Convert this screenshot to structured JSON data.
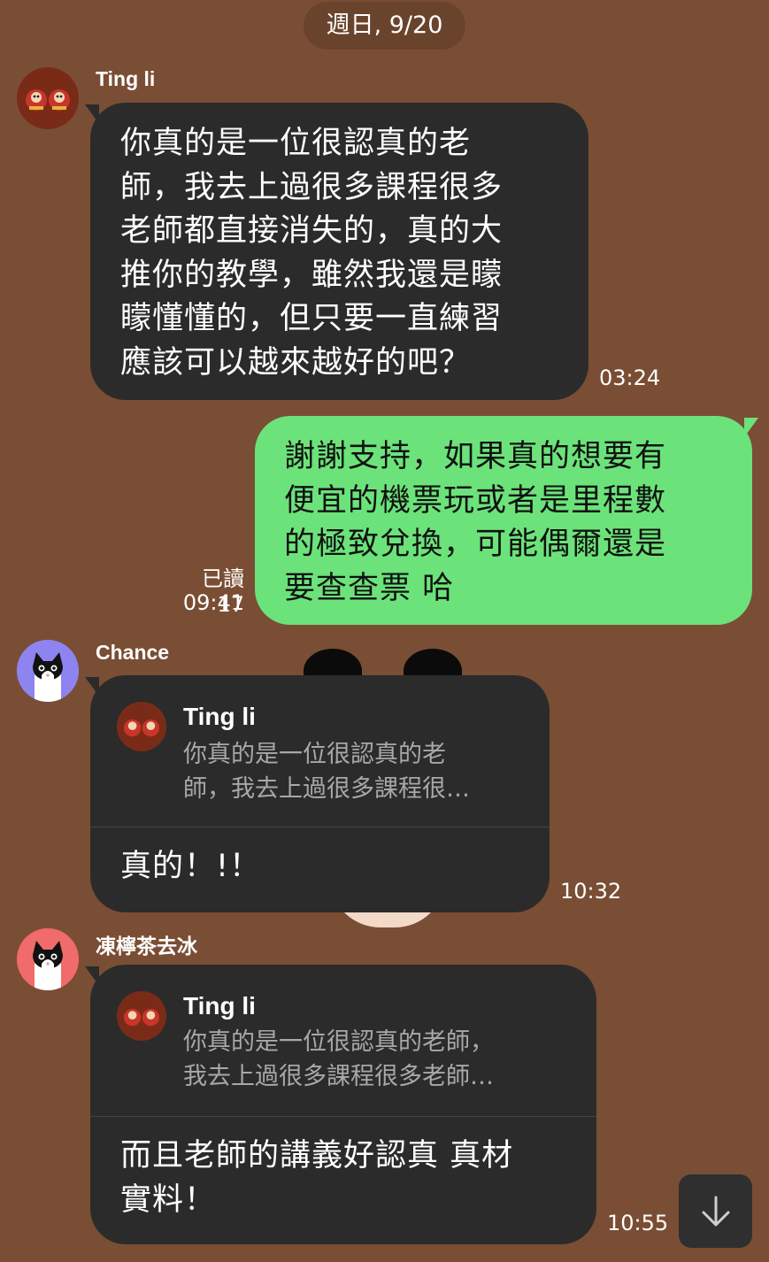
{
  "date_separator": "週日, 9/20",
  "messages": [
    {
      "sender": "Ting li",
      "lines": [
        "你真的是一位很認真的老",
        "師，我去上過很多課程很多",
        "老師都直接消失的，真的大",
        "推你的教學，雖然我還是矇",
        "矇懂懂的，但只要一直練習",
        "應該可以越來越好的吧？"
      ],
      "time": "03:24"
    },
    {
      "sender": "self",
      "lines": [
        "謝謝支持，如果真的想要有",
        "便宜的機票玩或者是里程數",
        "的極致兌換，可能偶爾還是",
        "要查查票 哈"
      ],
      "read_status": "已讀 17",
      "time": "09:41"
    },
    {
      "sender": "Chance",
      "reply_to": {
        "name": "Ting li",
        "lines": [
          "你真的是一位很認真的老",
          "師，我去上過很多課程很…"
        ]
      },
      "lines": [
        "真的！!！"
      ],
      "time": "10:32"
    },
    {
      "sender": "凍檸茶去冰",
      "reply_to": {
        "name": "Ting li",
        "lines": [
          "你真的是一位很認真的老師，",
          "我去上過很多課程很多老師…"
        ]
      },
      "lines": [
        "而且老師的講義好認真 真材",
        "實料！"
      ],
      "time": "10:55"
    }
  ],
  "icons": {
    "scroll_down": "arrow-down-icon"
  },
  "colors": {
    "background": "#7a4e34",
    "incoming_bubble": "#2b2b2b",
    "outgoing_bubble": "#6be37a"
  }
}
